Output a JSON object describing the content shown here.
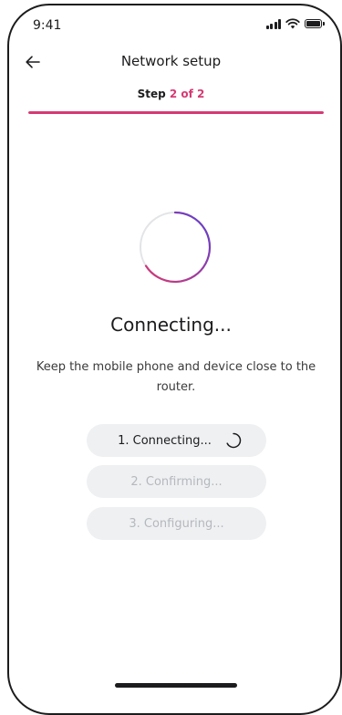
{
  "status_bar": {
    "time": "9:41",
    "icons": [
      "signal-icon",
      "wifi-icon",
      "battery-icon"
    ]
  },
  "header": {
    "back_icon": "arrow-left-icon",
    "title": "Network setup",
    "step_prefix": "Step",
    "step_current": "2 of 2",
    "progress_fraction": 1.0
  },
  "loader": {
    "icon": "circular-progress-icon",
    "gradient_start": "#5b3fd1",
    "gradient_end": "#d63a73"
  },
  "main": {
    "heading": "Connecting...",
    "description": "Keep the mobile phone and device close to the router."
  },
  "steps": [
    {
      "label": "1. Connecting...",
      "state": "active"
    },
    {
      "label": "2. Confirming...",
      "state": "pending"
    },
    {
      "label": "3. Configuring...",
      "state": "pending"
    }
  ],
  "colors": {
    "accent": "#d63a73",
    "text": "#1c1c1e",
    "pill_bg": "#eef0f2",
    "muted_text": "#b5b8bd"
  }
}
